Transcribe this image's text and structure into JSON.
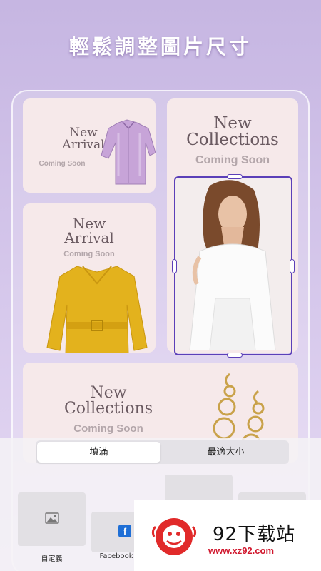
{
  "header": {
    "title": "輕鬆調整圖片尺寸"
  },
  "cards": [
    {
      "line1": "New",
      "line2": "Arrival",
      "subtitle": "Coming Soon",
      "image": "purple-shirt"
    },
    {
      "line1": "New",
      "line2": "Collections",
      "subtitle": "Coming Soon",
      "image": "model-photo"
    },
    {
      "line1": "New",
      "line2": "Arrival",
      "subtitle": "Coming Soon",
      "image": "yellow-coat"
    },
    {
      "line1": "New",
      "line2": "Collections",
      "subtitle": "Coming Soon",
      "image": "gold-earring"
    }
  ],
  "segment": {
    "options": [
      "填滿",
      "最適大小"
    ],
    "selected": "填滿"
  },
  "sizes": [
    {
      "label": "自定義",
      "icon": "image-icon"
    },
    {
      "label": "Facebook",
      "icon": "facebook-icon"
    }
  ],
  "watermark": {
    "brand": "92下载站",
    "url": "www.xz92.com"
  },
  "colors": {
    "accent": "#5b3fb8",
    "card_bg": "#f6e9ea",
    "coat": "#e3b21d",
    "shirt": "#c7a4d8"
  }
}
